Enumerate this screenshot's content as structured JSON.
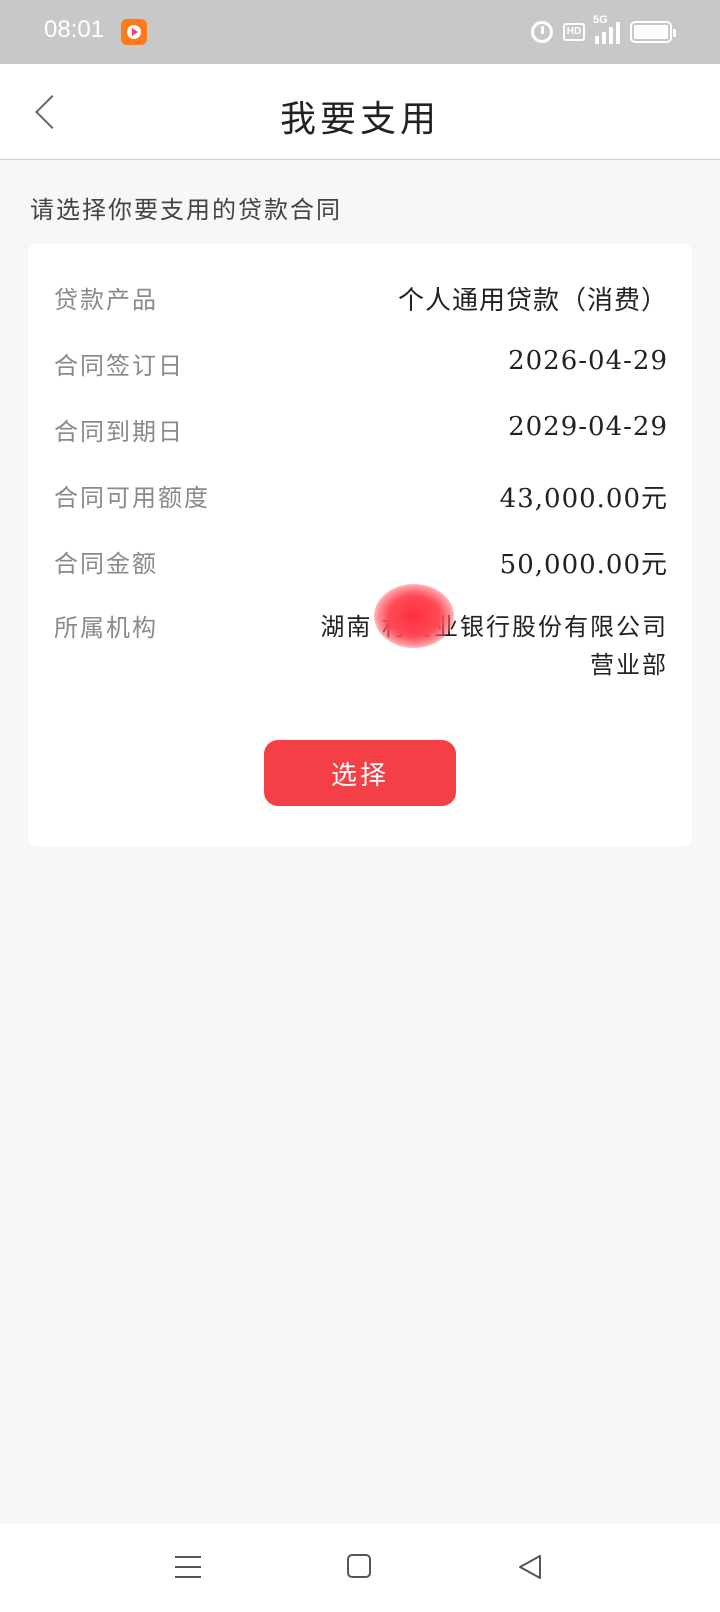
{
  "statusbar": {
    "time": "08:01",
    "network": "5G",
    "hd": "HD",
    "icons": [
      "app-icon",
      "alarm-icon",
      "hd-icon",
      "signal-icon",
      "battery-icon"
    ]
  },
  "header": {
    "title": "我要支用",
    "back_icon": "chevron-left-icon"
  },
  "subtitle": "请选择你要支用的贷款合同",
  "contract": {
    "rows": [
      {
        "label": "贷款产品",
        "value": "个人通用贷款（消费）"
      },
      {
        "label": "合同签订日",
        "value": "2026-04-29"
      },
      {
        "label": "合同到期日",
        "value": "2029-04-29"
      },
      {
        "label": "合同可用额度",
        "value": "43,000.00元"
      },
      {
        "label": "合同金额",
        "value": "50,000.00元"
      },
      {
        "label": "所属机构",
        "value": "湖南 村商业银行股份有限公司营业部"
      }
    ],
    "select_label": "选择"
  },
  "colors": {
    "accent": "#f53f46",
    "statusbar": "#c8c8c8",
    "background": "#f7f7f7",
    "label": "#8a8a8a"
  },
  "sysnav": {
    "icons": [
      "menu-icon",
      "home-icon",
      "back-triangle-icon"
    ]
  }
}
